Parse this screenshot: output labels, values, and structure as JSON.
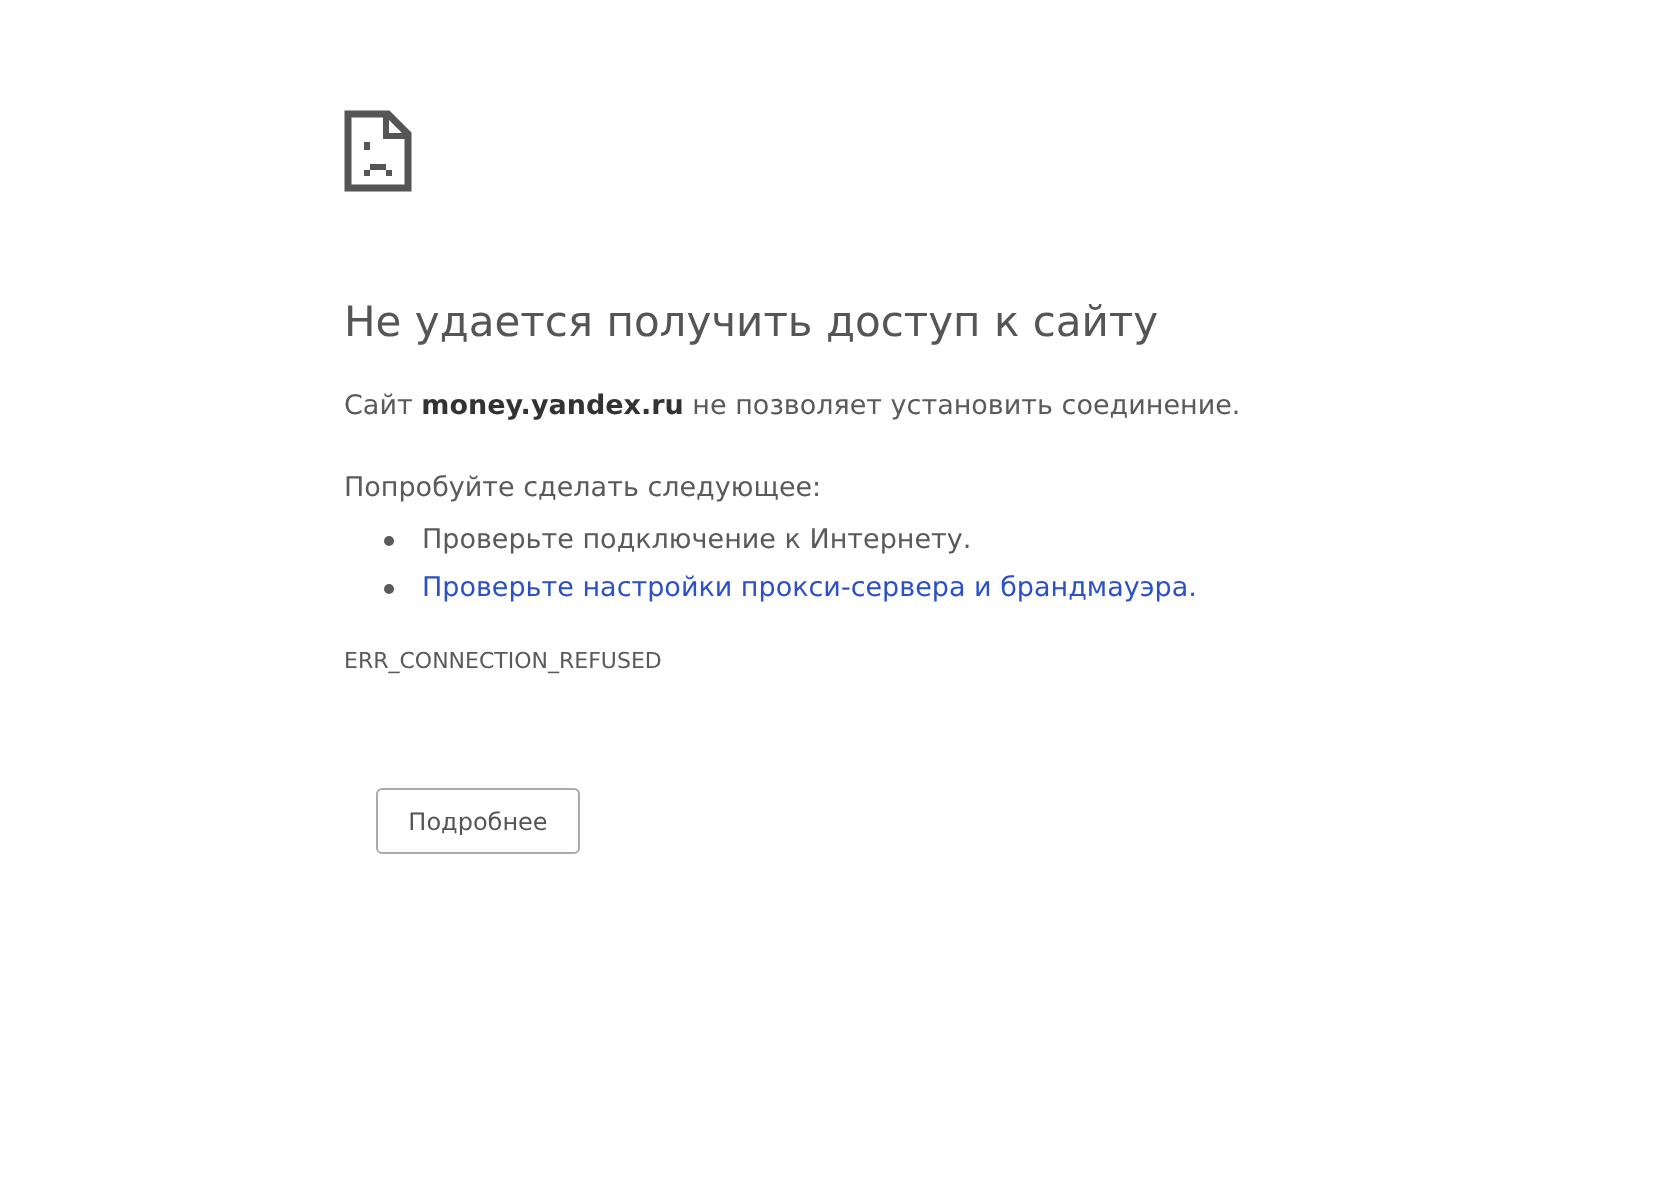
{
  "heading": "Не удается получить доступ к сайту",
  "message": "Сайт **money.yandex.ru** не позволяет установить соединение.",
  "suggestions_intro": "Попробуйте сделать следующее:",
  "suggestions": [
    {
      "kind": "text",
      "text": "Проверьте подключение к Интернету."
    },
    {
      "kind": "link",
      "text": "Проверьте настройки прокси-сервера и брандмауэра."
    }
  ],
  "error_code": "ERR_CONNECTION_REFUSED",
  "details_button": "Подробнее"
}
